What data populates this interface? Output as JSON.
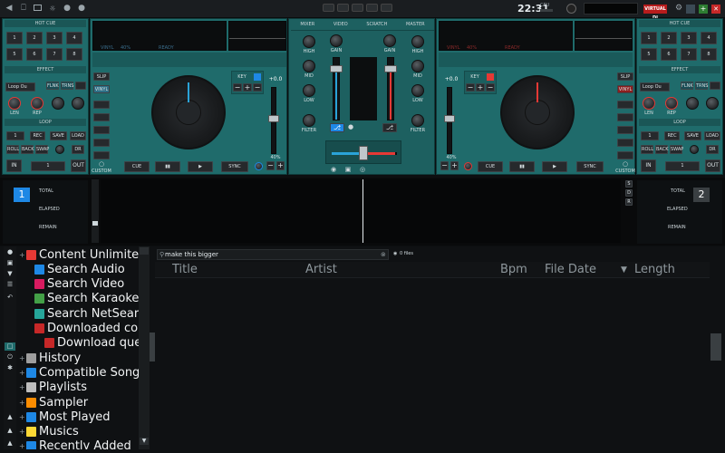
{
  "topbar": {
    "clock": "22:31",
    "cpu_label": "CPU",
    "brand": "VIRTUAL DJ"
  },
  "left_panel": {
    "hotcue_title": "HOT CUE",
    "hotcue_buttons": [
      "1",
      "2",
      "3",
      "4",
      "5",
      "6",
      "7",
      "8"
    ],
    "effect_title": "EFFECT",
    "effect_select": "Loop Ou",
    "effect_btn_a": "FLNK",
    "effect_btn_b": "TRNS",
    "knob_a": "LEN",
    "knob_b": "REP",
    "loop_title": "LOOP",
    "loop_row1": [
      "1",
      "REC",
      "SAVE",
      "LOAD"
    ],
    "loop_row2": [
      "ROLL",
      "BACK",
      "SWAP",
      "",
      "DR"
    ],
    "in_label": "IN",
    "out_label": "OUT",
    "loop_value": "1"
  },
  "right_panel": {
    "hotcue_title": "HOT CUE",
    "hotcue_buttons": [
      "1",
      "2",
      "3",
      "4",
      "5",
      "6",
      "7",
      "8"
    ],
    "effect_title": "EFFECT",
    "effect_select": "Loop Ou",
    "effect_btn_a": "FLNK",
    "effect_btn_b": "TRNS",
    "knob_a": "LEN",
    "knob_b": "REP",
    "loop_title": "LOOP",
    "loop_row1": [
      "1",
      "REC",
      "SAVE",
      "LOAD"
    ],
    "loop_row2": [
      "ROLL",
      "BACK",
      "SWAP",
      "",
      "DR"
    ],
    "in_label": "IN",
    "out_label": "OUT",
    "loop_value": "1"
  },
  "deck_left": {
    "vinyl": "VINYL",
    "pct": "40%",
    "ready": "READY",
    "slip": "SLIP",
    "vinyl_btn": "VINYL",
    "custom": "CUSTOM",
    "key": "KEY",
    "pitch": "+0.0",
    "range": "40%",
    "cue": "CUE",
    "play": "▶",
    "pause": "▮▮",
    "sync": "SYNC"
  },
  "deck_right": {
    "vinyl": "VINYL",
    "pct": "40%",
    "ready": "READY",
    "slip": "SLIP",
    "vinyl_btn": "VINYL",
    "custom": "CUSTOM",
    "key": "KEY",
    "pitch": "+0.0",
    "range": "40%",
    "cue": "CUE",
    "play": "▶",
    "pause": "▮▮",
    "sync": "SYNC"
  },
  "mixer": {
    "tabs": [
      "MIXER",
      "VIDEO",
      "SCRATCH",
      "MASTER"
    ],
    "gain": "GAIN",
    "high": "HIGH",
    "mid": "MID",
    "low": "LOW",
    "filter": "FILTER"
  },
  "waveform": {
    "left": {
      "deck": "1",
      "total": "TOTAL",
      "elapsed": "ELAPSED",
      "remain": "REMAIN"
    },
    "right": {
      "deck": "2",
      "total": "TOTAL",
      "elapsed": "ELAPSED",
      "remain": "REMAIN"
    },
    "sdr": [
      "S",
      "D",
      "R"
    ]
  },
  "browser": {
    "tree": [
      {
        "label": "Content Unlimited",
        "color": "#e53935"
      },
      {
        "label": "Search Audio",
        "color": "#1e88e5"
      },
      {
        "label": "Search Video",
        "color": "#d81b60"
      },
      {
        "label": "Search Karaoke",
        "color": "#43a047"
      },
      {
        "label": "Search NetSearch",
        "color": "#26a69a"
      },
      {
        "label": "Downloaded cor",
        "color": "#c62828"
      },
      {
        "label": "Download que",
        "color": "#c62828"
      },
      {
        "label": "History",
        "color": "#9e9e9e"
      },
      {
        "label": "Compatible Songs",
        "color": "#1e88e5"
      },
      {
        "label": "Playlists",
        "color": "#bdbdbd"
      },
      {
        "label": "Sampler",
        "color": "#fb8c00"
      },
      {
        "label": "Most Played",
        "color": "#1e88e5"
      },
      {
        "label": "Musics",
        "color": "#fdd835"
      },
      {
        "label": "Recently Added",
        "color": "#1e88e5"
      }
    ],
    "search_value": "make this bigger",
    "file_count": "0 files",
    "columns": [
      "Title",
      "Artist",
      "Bpm",
      "File Date",
      "Length"
    ]
  },
  "colors": {
    "panel": "#1f6b6b",
    "accent": "#1e88e5",
    "red": "#e53935"
  }
}
